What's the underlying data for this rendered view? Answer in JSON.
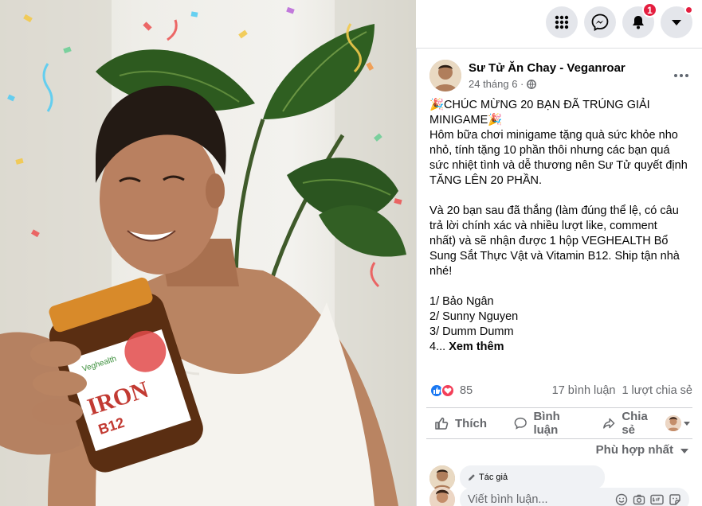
{
  "header": {
    "menu_icon": "grid-menu-icon",
    "messenger_icon": "messenger-icon",
    "notifications_icon": "bell-icon",
    "notification_count": "1",
    "account_icon": "caret-down-icon"
  },
  "post": {
    "author": "Sư Tử Ăn Chay - Veganroar",
    "date": "24 tháng 6 ·",
    "lines": [
      "🎉CHÚC MỪNG 20 BẠN ĐÃ TRÚNG GIẢI",
      "MINIGAME🎉",
      "Hôm bữa chơi minigame tặng quà sức khỏe nho",
      "nhỏ, tính tặng 10 phần thôi nhưng các bạn quá",
      "sức nhiệt tình và dễ thương nên Sư Tử quyết định",
      "TĂNG LÊN 20 PHẦN.",
      "",
      "Và 20 bạn sau đã thắng (làm đúng thể lệ, có câu",
      "trả lời chính xác và nhiều lượt like, comment",
      "nhất) và sẽ nhận được 1 hộp VEGHEALTH Bổ",
      "Sung Sắt Thực Vật và Vitamin B12. Ship tận nhà",
      "nhé!",
      "",
      "1/ Bảo Ngân",
      "2/ Sunny Nguyen",
      "3/ Dumm Dumm"
    ],
    "last_line_prefix": "4... ",
    "see_more": "Xem thêm"
  },
  "stats": {
    "reaction_count": "85",
    "comments": "17 bình luận",
    "shares": "1 lượt chia sẻ"
  },
  "actions": {
    "like": "Thích",
    "comment": "Bình luận",
    "share": "Chia sẻ"
  },
  "sort": {
    "label": "Phù hợp nhất"
  },
  "comment": {
    "author_badge": "Tác giả"
  },
  "composer": {
    "placeholder": "Viết bình luận..."
  },
  "product": {
    "brand": "Veghealth",
    "label_main": "IRON",
    "label_sub": "B12"
  },
  "colors": {
    "accent_blue": "#1877f2",
    "notification_red": "#e41e3f",
    "muted_text": "#65676b",
    "love_red": "#f33e58"
  }
}
